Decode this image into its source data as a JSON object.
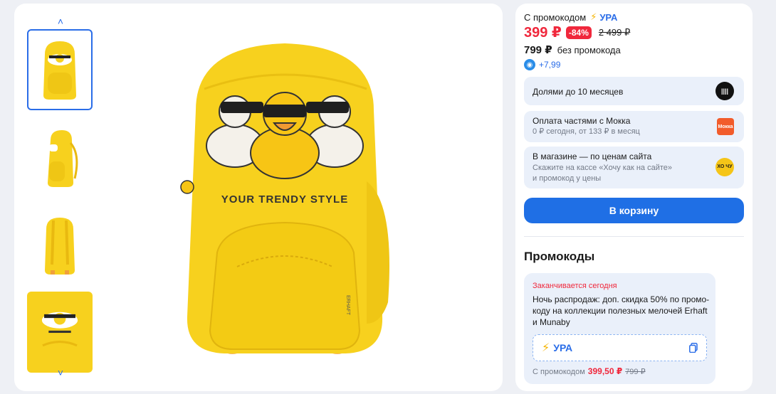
{
  "gallery": {
    "up_arrow": "˄",
    "down_arrow": "˅",
    "thumbnails": [
      {
        "view": "front"
      },
      {
        "view": "side"
      },
      {
        "view": "back"
      },
      {
        "view": "detail"
      }
    ],
    "main_image": {
      "print_text": "YOUR TRENDY STYLE",
      "tag_text": "ERHAFT"
    }
  },
  "buy": {
    "promo_label": "С промокодом",
    "promo_code": "УРА",
    "price": "399 ₽",
    "discount": "-84%",
    "old_price": "2 499 ₽",
    "price_no_promo": "799 ₽",
    "price_no_promo_label": "без промокода",
    "bonus": "+7,99",
    "payments": [
      {
        "title": "Долями до 10 месяцев",
        "subtitle": "",
        "icon": "dolyami-icon"
      },
      {
        "title": "Оплата частями с Мокка",
        "subtitle": "0 ₽ сегодня, от 133 ₽ в месяц",
        "icon": "mokka-icon",
        "icon_text": "Мокка"
      },
      {
        "title": "В магазине — по ценам сайта",
        "subtitle_line1": "Скажите на кассе «Хочу как на сайте»",
        "subtitle_line2": "и промокод у цены",
        "icon": "hochu-icon",
        "icon_text": "ХО ЧУ"
      }
    ],
    "cart_button": "В корзину",
    "promos_title": "Промокоды",
    "promo_card": {
      "expires": "Заканчивается сегодня",
      "description": "Ночь распродаж: доп. скидка 50% по промо-коду на коллекции полезных мелочей Erhaft и Munaby",
      "code": "УРА",
      "price_label": "С промокодом",
      "price": "399,50 ₽",
      "old_price": "799 ₽"
    }
  },
  "colors": {
    "accent": "#1f6fe5",
    "sale": "#f0283c",
    "backpack": "#f7d11e",
    "panel_bg": "#eaf0fa"
  }
}
